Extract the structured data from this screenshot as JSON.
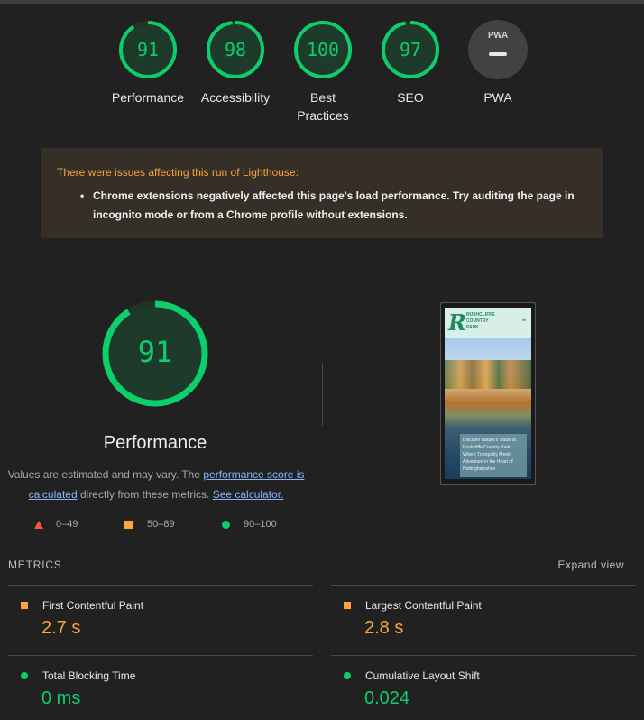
{
  "colors": {
    "pass": "#0cce6b",
    "average": "#ffa33c",
    "fail": "#ff4e42",
    "background": "#212121"
  },
  "gauges": [
    {
      "score": "91",
      "label": "Performance",
      "value": 0.91
    },
    {
      "score": "98",
      "label": "Accessibility",
      "value": 0.98
    },
    {
      "score": "100",
      "label": "Best Practices",
      "value": 1.0
    },
    {
      "score": "97",
      "label": "SEO",
      "value": 0.97
    }
  ],
  "pwa": {
    "badge_text": "PWA",
    "label": "PWA"
  },
  "warning": {
    "title": "There were issues affecting this run of Lighthouse:",
    "item_line1": "Chrome extensions negatively affected this page's load performance. Try auditing the page in",
    "item_line2": "incognito mode or from a Chrome profile without extensions."
  },
  "performance": {
    "score": "91",
    "value": 0.91,
    "title": "Performance",
    "desc_part1": "Values are estimated and may vary. The ",
    "desc_link1": "performance score is calculated",
    "desc_part2": " directly from these metrics. ",
    "desc_link2": "See calculator."
  },
  "legend": {
    "fail": "0–49",
    "average": "50–89",
    "pass": "90–100"
  },
  "thumbnail": {
    "brand_line1": "RUSHCLIFFE",
    "brand_line2": "COUNTRY",
    "brand_line3": "PARK",
    "logo_letter": "R",
    "menu_icon": "≡",
    "caption": "Discover Nature's Oasis at Rushcliffe Country Park: Where Tranquility Meets Adventure in the Heart of Nottinghamshire"
  },
  "metrics": {
    "title": "METRICS",
    "expand_label": "Expand view",
    "items": [
      {
        "name": "First Contentful Paint",
        "value": "2.7 s",
        "status": "average"
      },
      {
        "name": "Largest Contentful Paint",
        "value": "2.8 s",
        "status": "average"
      },
      {
        "name": "Total Blocking Time",
        "value": "0 ms",
        "status": "pass"
      },
      {
        "name": "Cumulative Layout Shift",
        "value": "0.024",
        "status": "pass"
      }
    ]
  }
}
